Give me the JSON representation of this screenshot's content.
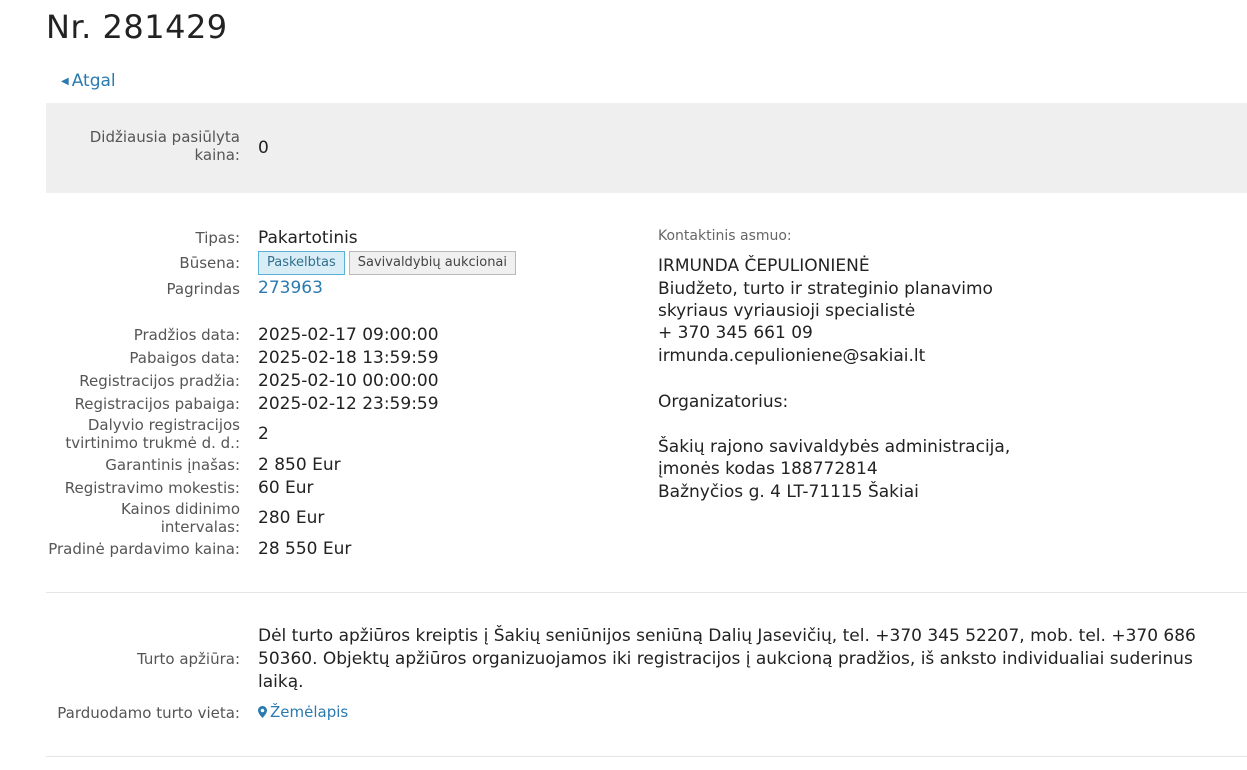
{
  "title": "Nr. 281429",
  "back_label": "Atgal",
  "highest_price": {
    "label": "Didžiausia pasiūlyta kaina:",
    "value": "0"
  },
  "details": [
    {
      "label": "Tipas:",
      "value": "Pakartotinis"
    },
    {
      "label": "Būsena:",
      "badges": [
        "Paskelbtas",
        "Savivaldybių aukcionai"
      ]
    },
    {
      "label": "Pagrindas",
      "value": "273963"
    },
    {
      "label": "Pradžios data:",
      "value": "2025-02-17 09:00:00"
    },
    {
      "label": "Pabaigos data:",
      "value": "2025-02-18 13:59:59"
    },
    {
      "label": "Registracijos pradžia:",
      "value": "2025-02-10 00:00:00"
    },
    {
      "label": "Registracijos pabaiga:",
      "value": "2025-02-12 23:59:59"
    },
    {
      "label": "Dalyvio registracijos tvirtinimo trukmė d. d.:",
      "value": "2"
    },
    {
      "label": "Garantinis įnašas:",
      "value": "2 850 Eur"
    },
    {
      "label": "Registravimo mokestis:",
      "value": "60 Eur"
    },
    {
      "label": "Kainos didinimo intervalas:",
      "value": "280 Eur"
    },
    {
      "label": "Pradinė pardavimo kaina:",
      "value": "28 550 Eur"
    }
  ],
  "contact": {
    "label": "Kontaktinis asmuo:",
    "name": "IRMUNDA ČEPULIONIENĖ",
    "position_line1": "Biudžeto, turto ir strateginio planavimo",
    "position_line2": "skyriaus vyriausioji specialistė",
    "phone": "+ 370 345 661 09",
    "email": "irmunda.cepulioniene@sakiai.lt"
  },
  "organizer": {
    "label": "Organizatorius:",
    "name": "Šakių rajono savivaldybės administracija,",
    "code": "įmonės kodas 188772814",
    "address": "Bažnyčios g. 4 LT-71115 Šakiai"
  },
  "property_review": {
    "label": "Turto apžiūra:",
    "text": "Dėl turto apžiūros kreiptis į Šakių seniūnijos seniūną Dalių Jasevičių, tel. +370 345 52207, mob. tel. +370 686 50360. Objektų apžiūros organizuojamos iki registracijos į aukcioną pradžios, iš anksto individualiai suderinus laiką."
  },
  "location": {
    "label": "Parduodamo turto vieta:",
    "map_label": "Žemėlapis"
  },
  "colors": {
    "link": "#2a7ab0",
    "panel_bg": "#efefef",
    "badge_primary_bg": "#d9edf7",
    "badge_primary_border": "#5bb0d8"
  }
}
